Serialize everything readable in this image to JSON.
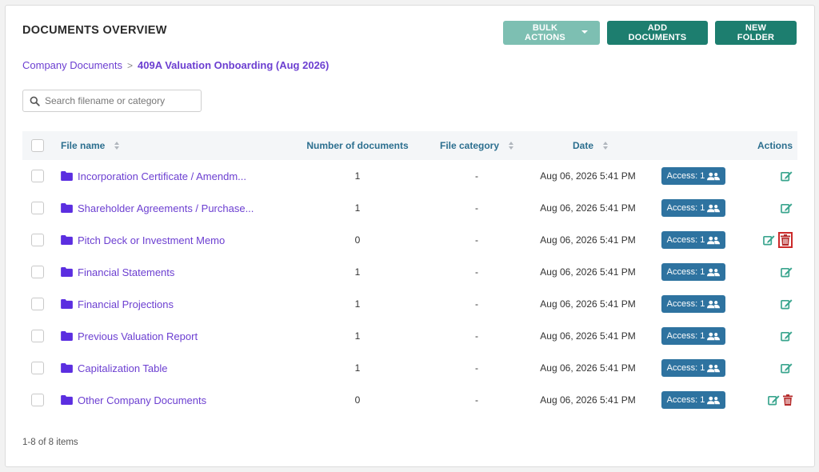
{
  "header": {
    "title": "DOCUMENTS OVERVIEW",
    "bulk_actions_label": "BULK ACTIONS",
    "add_documents_label": "ADD DOCUMENTS",
    "new_folder_label": "NEW FOLDER"
  },
  "breadcrumb": {
    "root": "Company Documents",
    "separator": ">",
    "current": "409A Valuation Onboarding (Aug 2026)"
  },
  "search": {
    "placeholder": "Search filename or category",
    "value": ""
  },
  "table": {
    "columns": {
      "file_name": "File name",
      "count": "Number of documents",
      "category": "File category",
      "date": "Date",
      "actions": "Actions"
    },
    "rows": [
      {
        "name": "Incorporation Certificate / Amendments",
        "display_name": "Incorporation Certificate / Amendm...",
        "count": "1",
        "category": "-",
        "date": "Aug 06, 2026 5:41 PM",
        "access": "Access: 1",
        "deletable": false
      },
      {
        "name": "Shareholder Agreements / Purchase Agreements",
        "display_name": "Shareholder Agreements / Purchase...",
        "count": "1",
        "category": "-",
        "date": "Aug 06, 2026 5:41 PM",
        "access": "Access: 1",
        "deletable": false
      },
      {
        "name": "Pitch Deck or Investment Memo",
        "display_name": "Pitch Deck or Investment Memo",
        "count": "0",
        "category": "-",
        "date": "Aug 06, 2026 5:41 PM",
        "access": "Access: 1",
        "deletable": true,
        "highlighted": true
      },
      {
        "name": "Financial Statements",
        "display_name": "Financial Statements",
        "count": "1",
        "category": "-",
        "date": "Aug 06, 2026 5:41 PM",
        "access": "Access: 1",
        "deletable": false
      },
      {
        "name": "Financial Projections",
        "display_name": "Financial Projections",
        "count": "1",
        "category": "-",
        "date": "Aug 06, 2026 5:41 PM",
        "access": "Access: 1",
        "deletable": false
      },
      {
        "name": "Previous Valuation Report",
        "display_name": "Previous Valuation Report",
        "count": "1",
        "category": "-",
        "date": "Aug 06, 2026 5:41 PM",
        "access": "Access: 1",
        "deletable": false
      },
      {
        "name": "Capitalization Table",
        "display_name": "Capitalization Table",
        "count": "1",
        "category": "-",
        "date": "Aug 06, 2026 5:41 PM",
        "access": "Access: 1",
        "deletable": false
      },
      {
        "name": "Other Company Documents",
        "display_name": "Other Company Documents",
        "count": "0",
        "category": "-",
        "date": "Aug 06, 2026 5:41 PM",
        "access": "Access: 1",
        "deletable": true
      }
    ]
  },
  "footer": {
    "pagination_text": "1-8 of 8 items"
  },
  "colors": {
    "primary_green": "#1d7e6f",
    "light_green": "#7dbfb2",
    "link_purple": "#6c3fd1",
    "folder_purple": "#5b2ee0",
    "access_blue": "#2e73a0",
    "edit_green": "#3aa58e",
    "delete_red": "#b52a2a",
    "header_text": "#2c6f8f"
  },
  "icons": {
    "search": "search-icon",
    "folder": "folder-icon",
    "edit": "edit-icon",
    "delete": "trash-icon",
    "users": "users-icon",
    "sort": "sort-icon",
    "caret": "caret-down-icon"
  }
}
